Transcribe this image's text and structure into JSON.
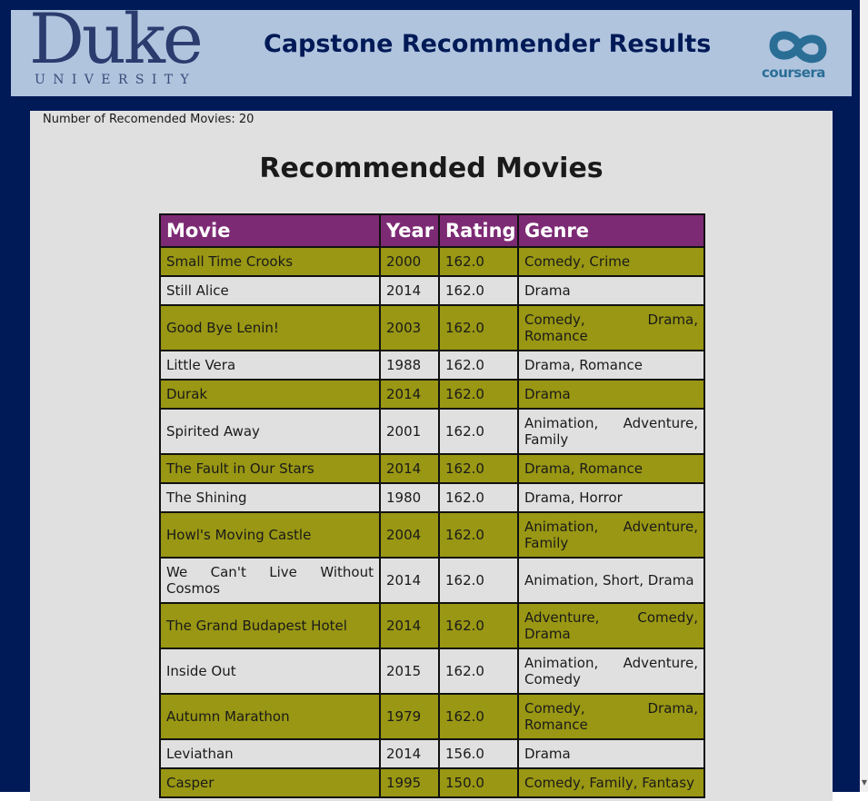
{
  "header": {
    "duke_word": "Duke",
    "duke_subtitle": "UNIVERSITY",
    "title": "Capstone Recommender Results",
    "coursera_word": "coursera"
  },
  "summary": {
    "count_text": "Number of Recomended Movies: 20"
  },
  "section_title": "Recommended Movies",
  "table": {
    "columns": [
      "Movie",
      "Year",
      "Rating",
      "Genre"
    ],
    "rows": [
      {
        "movie": "Small Time Crooks",
        "year": "2000",
        "rating": "162.0",
        "genre": "Comedy, Crime"
      },
      {
        "movie": "Still Alice",
        "year": "2014",
        "rating": "162.0",
        "genre": "Drama"
      },
      {
        "movie": "Good Bye Lenin!",
        "year": "2003",
        "rating": "162.0",
        "genre": "Comedy, Drama, Romance"
      },
      {
        "movie": "Little Vera",
        "year": "1988",
        "rating": "162.0",
        "genre": "Drama, Romance"
      },
      {
        "movie": "Durak",
        "year": "2014",
        "rating": "162.0",
        "genre": "Drama"
      },
      {
        "movie": "Spirited Away",
        "year": "2001",
        "rating": "162.0",
        "genre": "Animation, Adventure, Family"
      },
      {
        "movie": "The Fault in Our Stars",
        "year": "2014",
        "rating": "162.0",
        "genre": "Drama, Romance"
      },
      {
        "movie": "The Shining",
        "year": "1980",
        "rating": "162.0",
        "genre": "Drama, Horror"
      },
      {
        "movie": "Howl's Moving Castle",
        "year": "2004",
        "rating": "162.0",
        "genre": "Animation, Adventure, Family"
      },
      {
        "movie": "We Can't Live Without Cosmos",
        "year": "2014",
        "rating": "162.0",
        "genre": "Animation, Short, Drama"
      },
      {
        "movie": "The Grand Budapest Hotel",
        "year": "2014",
        "rating": "162.0",
        "genre": "Adventure, Comedy, Drama"
      },
      {
        "movie": "Inside Out",
        "year": "2015",
        "rating": "162.0",
        "genre": "Animation, Adventure, Comedy"
      },
      {
        "movie": "Autumn Marathon",
        "year": "1979",
        "rating": "162.0",
        "genre": "Comedy, Drama, Romance"
      },
      {
        "movie": "Leviathan",
        "year": "2014",
        "rating": "156.0",
        "genre": "Drama"
      },
      {
        "movie": "Casper",
        "year": "1995",
        "rating": "150.0",
        "genre": "Comedy, Family, Fantasy"
      }
    ]
  },
  "colors": {
    "frame": "#001a57",
    "header_bg": "#b0c4de",
    "panel_bg": "#e0e0e0",
    "table_header": "#7d2a74",
    "row_highlight": "#999713"
  }
}
